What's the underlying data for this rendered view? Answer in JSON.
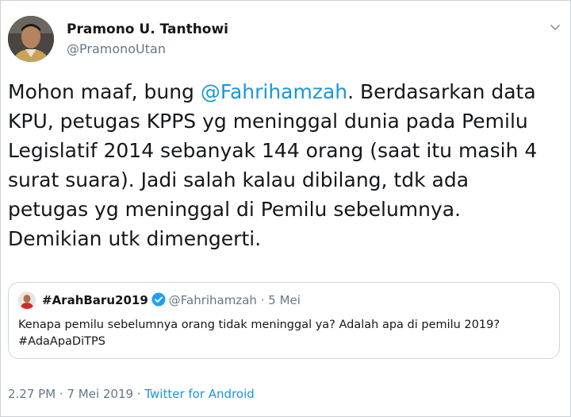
{
  "author": {
    "name": "Pramono U. Tanthowi",
    "handle": "@PramonoUtan"
  },
  "tweet": {
    "text_before": "Mohon maaf, bung ",
    "mention": "@Fahrihamzah",
    "text_after": ". Berdasarkan data KPU, petugas KPPS yg meninggal dunia pada Pemilu Legislatif 2014 sebanyak 144 orang (saat itu masih 4 surat suara). Jadi salah kalau dibilang, tdk ada petugas yg meninggal di Pemilu sebelumnya. Demikian utk dimengerti."
  },
  "quoted": {
    "name": "#ArahBaru2019",
    "handle": "@Fahrihamzah",
    "separator": "·",
    "date": "5 Mei",
    "text_line1": "Kenapa pemilu sebelumnya orang tidak meninggal ya? Adalah apa di pemilu 2019?",
    "text_line2": "#AdaApaDiTPS"
  },
  "footer": {
    "timestamp": "2.27 PM · 7 Mei 2019 · ",
    "source": "Twitter for Android"
  },
  "colors": {
    "link": "#1b95e0",
    "muted": "#657786",
    "verified": "#1da1f2"
  },
  "icons": {
    "menu": "chevron-down-icon",
    "verified": "verified-badge-icon"
  }
}
